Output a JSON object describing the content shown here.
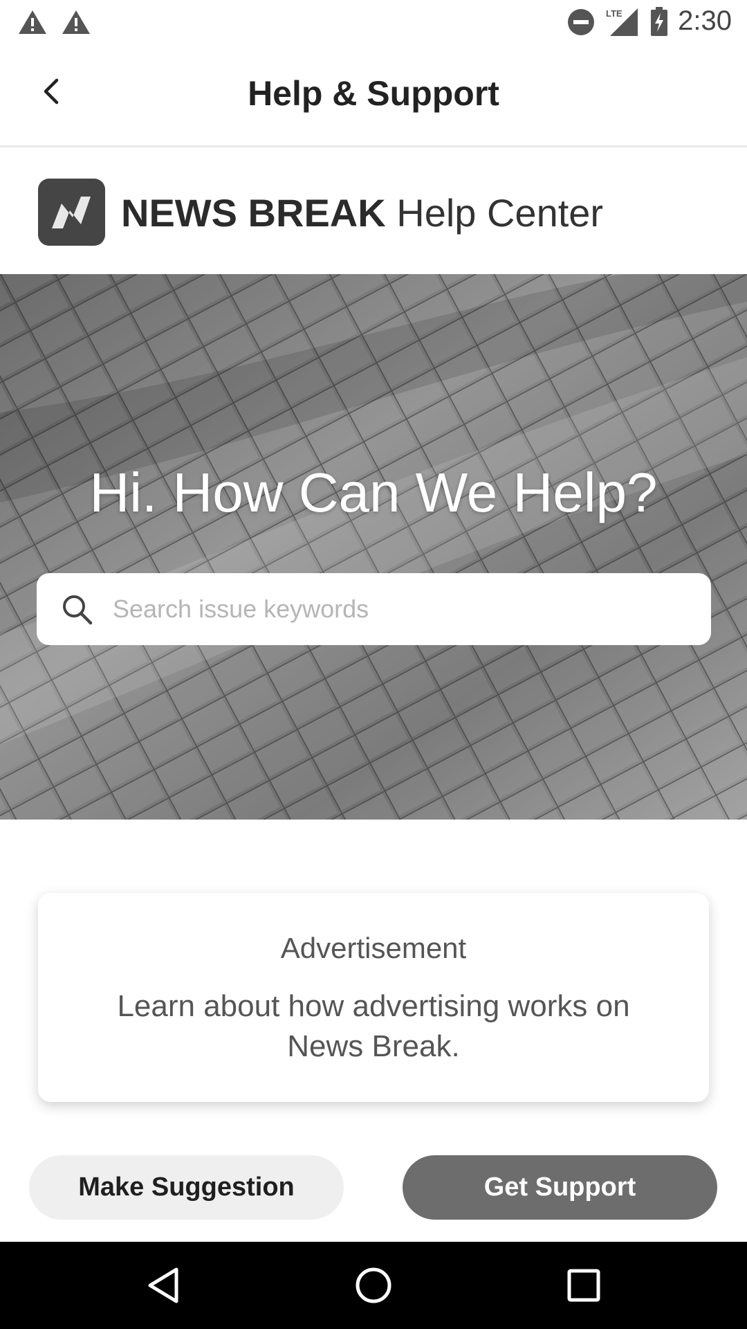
{
  "status_bar": {
    "time": "2:30",
    "icons": [
      "warning-icon",
      "warning-icon",
      "do-not-disturb-icon",
      "lte-signal-icon",
      "battery-charging-icon"
    ],
    "network_label": "LTE"
  },
  "app_bar": {
    "title": "Help & Support",
    "back_icon": "chevron-left-icon"
  },
  "brand": {
    "name_bold": "NEWS BREAK",
    "name_rest": " Help Center",
    "logo_icon": "news-break-logo"
  },
  "hero": {
    "headline": "Hi. How Can We Help?",
    "search": {
      "placeholder": "Search issue keywords",
      "value": ""
    }
  },
  "ad_card": {
    "title": "Advertisement",
    "text": "Learn about how advertising works on News Break."
  },
  "actions": {
    "suggest_label": "Make Suggestion",
    "support_label": "Get Support"
  },
  "nav_bar": {
    "icons": [
      "back-triangle-icon",
      "home-circle-icon",
      "recents-square-icon"
    ]
  },
  "colors": {
    "support_button": "#6d6d6d",
    "suggest_button": "#efefef",
    "nav_bar": "#000000"
  }
}
